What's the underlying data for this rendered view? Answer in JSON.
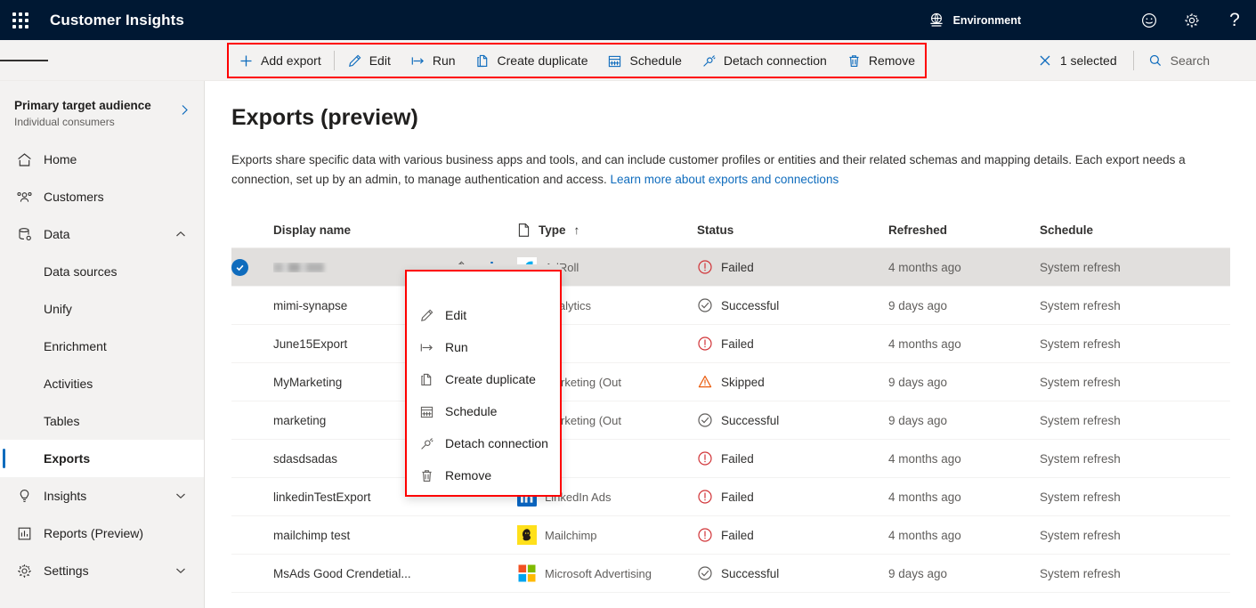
{
  "topbar": {
    "waffle_label": "app-launcher",
    "app_title": "Customer Insights",
    "environment_label": "Environment",
    "feedback_icon": "smiley-icon",
    "settings_icon": "gear-icon",
    "help_icon": "question-mark-icon",
    "help_glyph": "?"
  },
  "toolbar": {
    "items": [
      {
        "label": "Add export",
        "icon": "plus-icon"
      },
      {
        "label": "Edit",
        "icon": "pencil-icon"
      },
      {
        "label": "Run",
        "icon": "run-arrow-icon"
      },
      {
        "label": "Create duplicate",
        "icon": "copy-icon"
      },
      {
        "label": "Schedule",
        "icon": "calendar-icon"
      },
      {
        "label": "Detach connection",
        "icon": "detach-plug-icon"
      },
      {
        "label": "Remove",
        "icon": "trash-icon"
      }
    ],
    "selected_label": "1 selected",
    "selected_icon": "close-x-icon",
    "search_label": "Search",
    "search_icon": "search-icon",
    "highlight_color": "#ff0000"
  },
  "sidebar": {
    "audience_title": "Primary target audience",
    "audience_subtitle": "Individual consumers",
    "items": [
      {
        "label": "Home",
        "icon": "home-icon",
        "level": 0,
        "chevron": "",
        "active": false
      },
      {
        "label": "Customers",
        "icon": "customers-icon",
        "level": 0,
        "chevron": "",
        "active": false
      },
      {
        "label": "Data",
        "icon": "database-icon",
        "level": 0,
        "chevron": "up",
        "active": false
      },
      {
        "label": "Data sources",
        "icon": "",
        "level": 1,
        "chevron": "",
        "active": false
      },
      {
        "label": "Unify",
        "icon": "",
        "level": 1,
        "chevron": "",
        "active": false
      },
      {
        "label": "Enrichment",
        "icon": "",
        "level": 1,
        "chevron": "",
        "active": false
      },
      {
        "label": "Activities",
        "icon": "",
        "level": 1,
        "chevron": "",
        "active": false
      },
      {
        "label": "Tables",
        "icon": "",
        "level": 1,
        "chevron": "",
        "active": false
      },
      {
        "label": "Exports",
        "icon": "",
        "level": 1,
        "chevron": "",
        "active": true
      },
      {
        "label": "Insights",
        "icon": "lightbulb-icon",
        "level": 0,
        "chevron": "down",
        "active": false
      },
      {
        "label": "Reports (Preview)",
        "icon": "report-chart-icon",
        "level": 0,
        "chevron": "",
        "active": false
      },
      {
        "label": "Settings",
        "icon": "gear-icon",
        "level": 0,
        "chevron": "down",
        "active": false
      }
    ]
  },
  "main": {
    "page_title": "Exports (preview)",
    "description_part1": "Exports share specific data with various business apps and tools, and can include customer profiles or entities and their related schemas and mapping details. Each export needs a connection, set up by an admin, to manage authentication and access. ",
    "description_link": "Learn more about exports and connections",
    "columns": {
      "display_name": "Display name",
      "type": "Type",
      "type_sort": "↑",
      "type_icon": "document-icon",
      "status": "Status",
      "refreshed": "Refreshed",
      "schedule": "Schedule"
    },
    "rows": [
      {
        "name": "",
        "name_redacted": true,
        "type": "AdRoll",
        "logo": "adroll-logo",
        "status": "Failed",
        "status_icon": "error-icon",
        "refreshed": "4 months ago",
        "schedule": "System refresh",
        "selected": true,
        "has_pencil": true
      },
      {
        "name": "mimi-synapse",
        "name_redacted": false,
        "type": "Analytics",
        "logo": "",
        "status": "Successful",
        "status_icon": "success-icon",
        "refreshed": "9 days ago",
        "schedule": "System refresh",
        "selected": false,
        "has_pencil": false
      },
      {
        "name": "June15Export",
        "name_redacted": false,
        "type": "",
        "logo": "",
        "status": "Failed",
        "status_icon": "error-icon",
        "refreshed": "4 months ago",
        "schedule": "System refresh",
        "selected": false,
        "has_pencil": false
      },
      {
        "name": "MyMarketing",
        "name_redacted": false,
        "type": "Marketing (Out",
        "logo": "",
        "status": "Skipped",
        "status_icon": "warning-icon",
        "refreshed": "9 days ago",
        "schedule": "System refresh",
        "selected": false,
        "has_pencil": false
      },
      {
        "name": "marketing",
        "name_redacted": false,
        "type": "Marketing (Out",
        "logo": "",
        "status": "Successful",
        "status_icon": "success-icon",
        "refreshed": "9 days ago",
        "schedule": "System refresh",
        "selected": false,
        "has_pencil": false
      },
      {
        "name": "sdasdsadas",
        "name_redacted": false,
        "type": "",
        "logo": "",
        "status": "Failed",
        "status_icon": "error-icon",
        "refreshed": "4 months ago",
        "schedule": "System refresh",
        "selected": false,
        "has_pencil": false
      },
      {
        "name": "linkedinTestExport",
        "name_redacted": false,
        "type": "LinkedIn Ads",
        "logo": "linkedin-logo",
        "status": "Failed",
        "status_icon": "error-icon",
        "refreshed": "4 months ago",
        "schedule": "System refresh",
        "selected": false,
        "has_pencil": false
      },
      {
        "name": "mailchimp test",
        "name_redacted": false,
        "type": "Mailchimp",
        "logo": "mailchimp-logo",
        "status": "Failed",
        "status_icon": "error-icon",
        "refreshed": "4 months ago",
        "schedule": "System refresh",
        "selected": false,
        "has_pencil": false
      },
      {
        "name": "MsAds Good Crendetial...",
        "name_redacted": false,
        "type": "Microsoft Advertising",
        "logo": "microsoft-logo",
        "status": "Successful",
        "status_icon": "success-icon",
        "refreshed": "9 days ago",
        "schedule": "System refresh",
        "selected": false,
        "has_pencil": false
      }
    ]
  },
  "context_menu": {
    "items": [
      {
        "label": "Edit",
        "icon": "pencil-icon"
      },
      {
        "label": "Run",
        "icon": "run-arrow-icon"
      },
      {
        "label": "Create duplicate",
        "icon": "copy-icon"
      },
      {
        "label": "Schedule",
        "icon": "calendar-icon"
      },
      {
        "label": "Detach connection",
        "icon": "detach-plug-icon"
      },
      {
        "label": "Remove",
        "icon": "trash-icon"
      }
    ],
    "highlight_color": "#ff0000"
  },
  "colors": {
    "topbar_bg": "#001833",
    "accent": "#0f6cbd",
    "error": "#d13438",
    "warning": "#ea5c0e",
    "success": "#605e5c",
    "highlight": "#ff0000"
  }
}
